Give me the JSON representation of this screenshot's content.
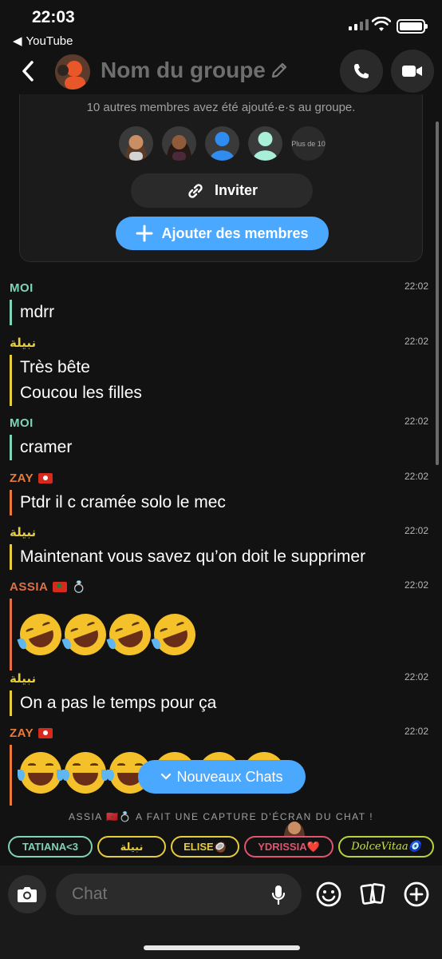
{
  "status_bar": {
    "time": "22:03",
    "back_app": "YouTube"
  },
  "header": {
    "title": "Nom du groupe"
  },
  "group_card": {
    "message": "10 autres membres avez été ajouté·e·s au groupe.",
    "more_members": "Plus de 10",
    "invite_label": "Inviter",
    "add_members_label": "Ajouter des membres"
  },
  "messages": [
    {
      "sender": "MOI",
      "time": "22:02",
      "lines": [
        "mdrr"
      ]
    },
    {
      "sender": "نبيلة",
      "time": "22:02",
      "lines": [
        "Très bête",
        "Coucou les filles"
      ]
    },
    {
      "sender": "MOI",
      "time": "22:02",
      "lines": [
        "cramer"
      ]
    },
    {
      "sender": "ZAY",
      "time": "22:02",
      "lines": [
        "Ptdr il c cramée solo le mec"
      ]
    },
    {
      "sender": "نبيلة",
      "time": "22:02",
      "lines": [
        "Maintenant vous savez qu’on doit le supprimer"
      ]
    },
    {
      "sender": "ASSIA",
      "time": "22:02",
      "lines": []
    },
    {
      "sender": "نبيلة",
      "time": "22:02",
      "lines": [
        "On a pas le temps pour ça"
      ]
    },
    {
      "sender": "ZAY",
      "time": "22:02",
      "lines": []
    }
  ],
  "new_chats_label": "Nouveaux Chats",
  "screenshot_notice": "ASSIA 🇲🇦💍 A FAIT UNE CAPTURE D’ÉCRAN DU CHAT !",
  "chips": [
    "TATIANA<3",
    "نبيلة",
    "ELISE🥥",
    "YDRISSIA❤️",
    "DolceVitaa🧿"
  ],
  "composer": {
    "placeholder": "Chat"
  },
  "colors": {
    "accent_blue": "#4aa8ff",
    "moi": "#7fd3b7",
    "nabila": "#e6cd3c",
    "zay": "#ea7a3a",
    "assia": "#e06f45"
  }
}
